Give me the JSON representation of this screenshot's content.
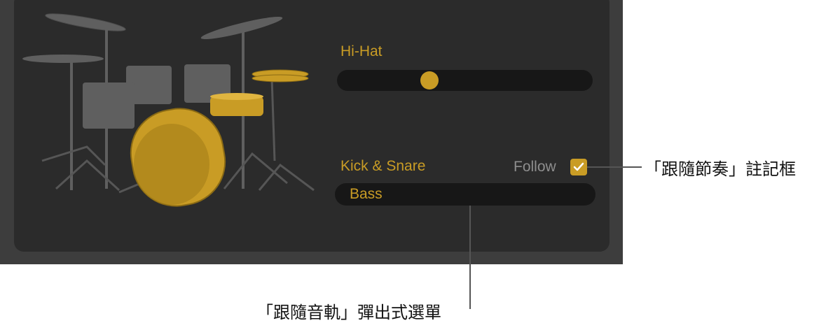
{
  "hihat": {
    "label": "Hi-Hat",
    "level": 0.35
  },
  "kick_snare": {
    "label": "Kick & Snare",
    "follow_label": "Follow",
    "follow_checked": true,
    "follow_check_glyph": "✓",
    "track_value": "Bass"
  },
  "callouts": {
    "follow_checkbox": "「跟隨節奏」註記框",
    "follow_track_popup": "「跟隨音軌」彈出式選單"
  },
  "colors": {
    "accent": "#c99c25",
    "panel": "#2b2b2b",
    "frame": "#3d3d3d",
    "drum_inactive": "#5f5f5f"
  },
  "icons": {
    "drum_kit": "drum-kit-icon",
    "checkbox": "checkmark-icon"
  }
}
